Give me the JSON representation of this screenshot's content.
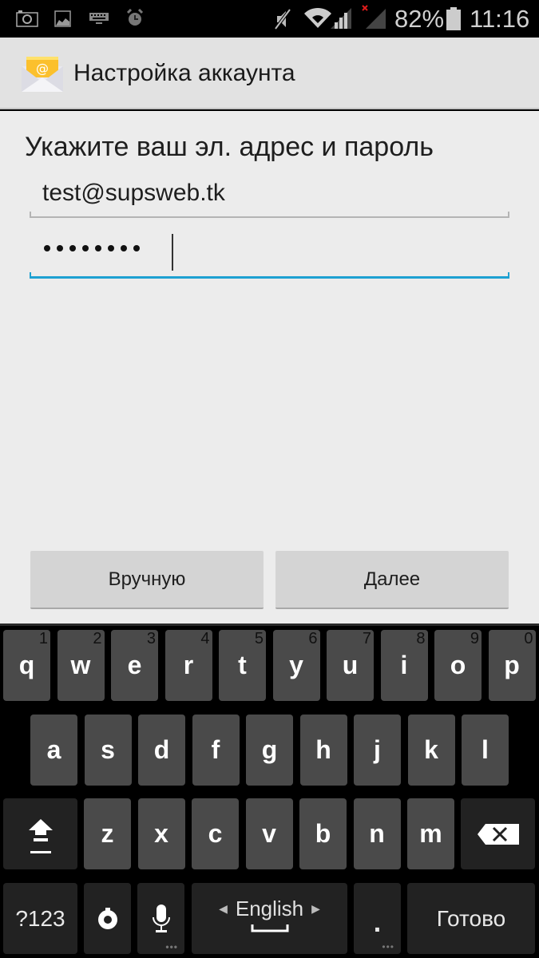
{
  "status_bar": {
    "left_icons": [
      "camera-icon",
      "image-icon",
      "keyboard-icon",
      "alarm-icon"
    ],
    "right_icons": [
      "mute-icon",
      "wifi-icon",
      "signal-icon",
      "signal-no-sim-icon",
      "battery-icon"
    ],
    "battery_percent": "82%",
    "time": "11:16"
  },
  "action_bar": {
    "icon": "email-app-icon",
    "title": "Настройка аккаунта"
  },
  "form": {
    "prompt": "Укажите ваш эл. адрес и пароль",
    "email_value": "test@supsweb.tk",
    "password_masked_length": 8,
    "accent_color": "#1ea1d2"
  },
  "buttons": {
    "manual": "Вручную",
    "next": "Далее"
  },
  "keyboard": {
    "row1": [
      {
        "k": "q",
        "h": "1"
      },
      {
        "k": "w",
        "h": "2"
      },
      {
        "k": "e",
        "h": "3"
      },
      {
        "k": "r",
        "h": "4"
      },
      {
        "k": "t",
        "h": "5"
      },
      {
        "k": "y",
        "h": "6"
      },
      {
        "k": "u",
        "h": "7"
      },
      {
        "k": "i",
        "h": "8"
      },
      {
        "k": "o",
        "h": "9"
      },
      {
        "k": "p",
        "h": "0"
      }
    ],
    "row2": [
      "a",
      "s",
      "d",
      "f",
      "g",
      "h",
      "j",
      "k",
      "l"
    ],
    "row3": [
      "z",
      "x",
      "c",
      "v",
      "b",
      "n",
      "m"
    ],
    "symbols_label": "?123",
    "language_label": "English",
    "period_label": ".",
    "done_label": "Готово"
  }
}
